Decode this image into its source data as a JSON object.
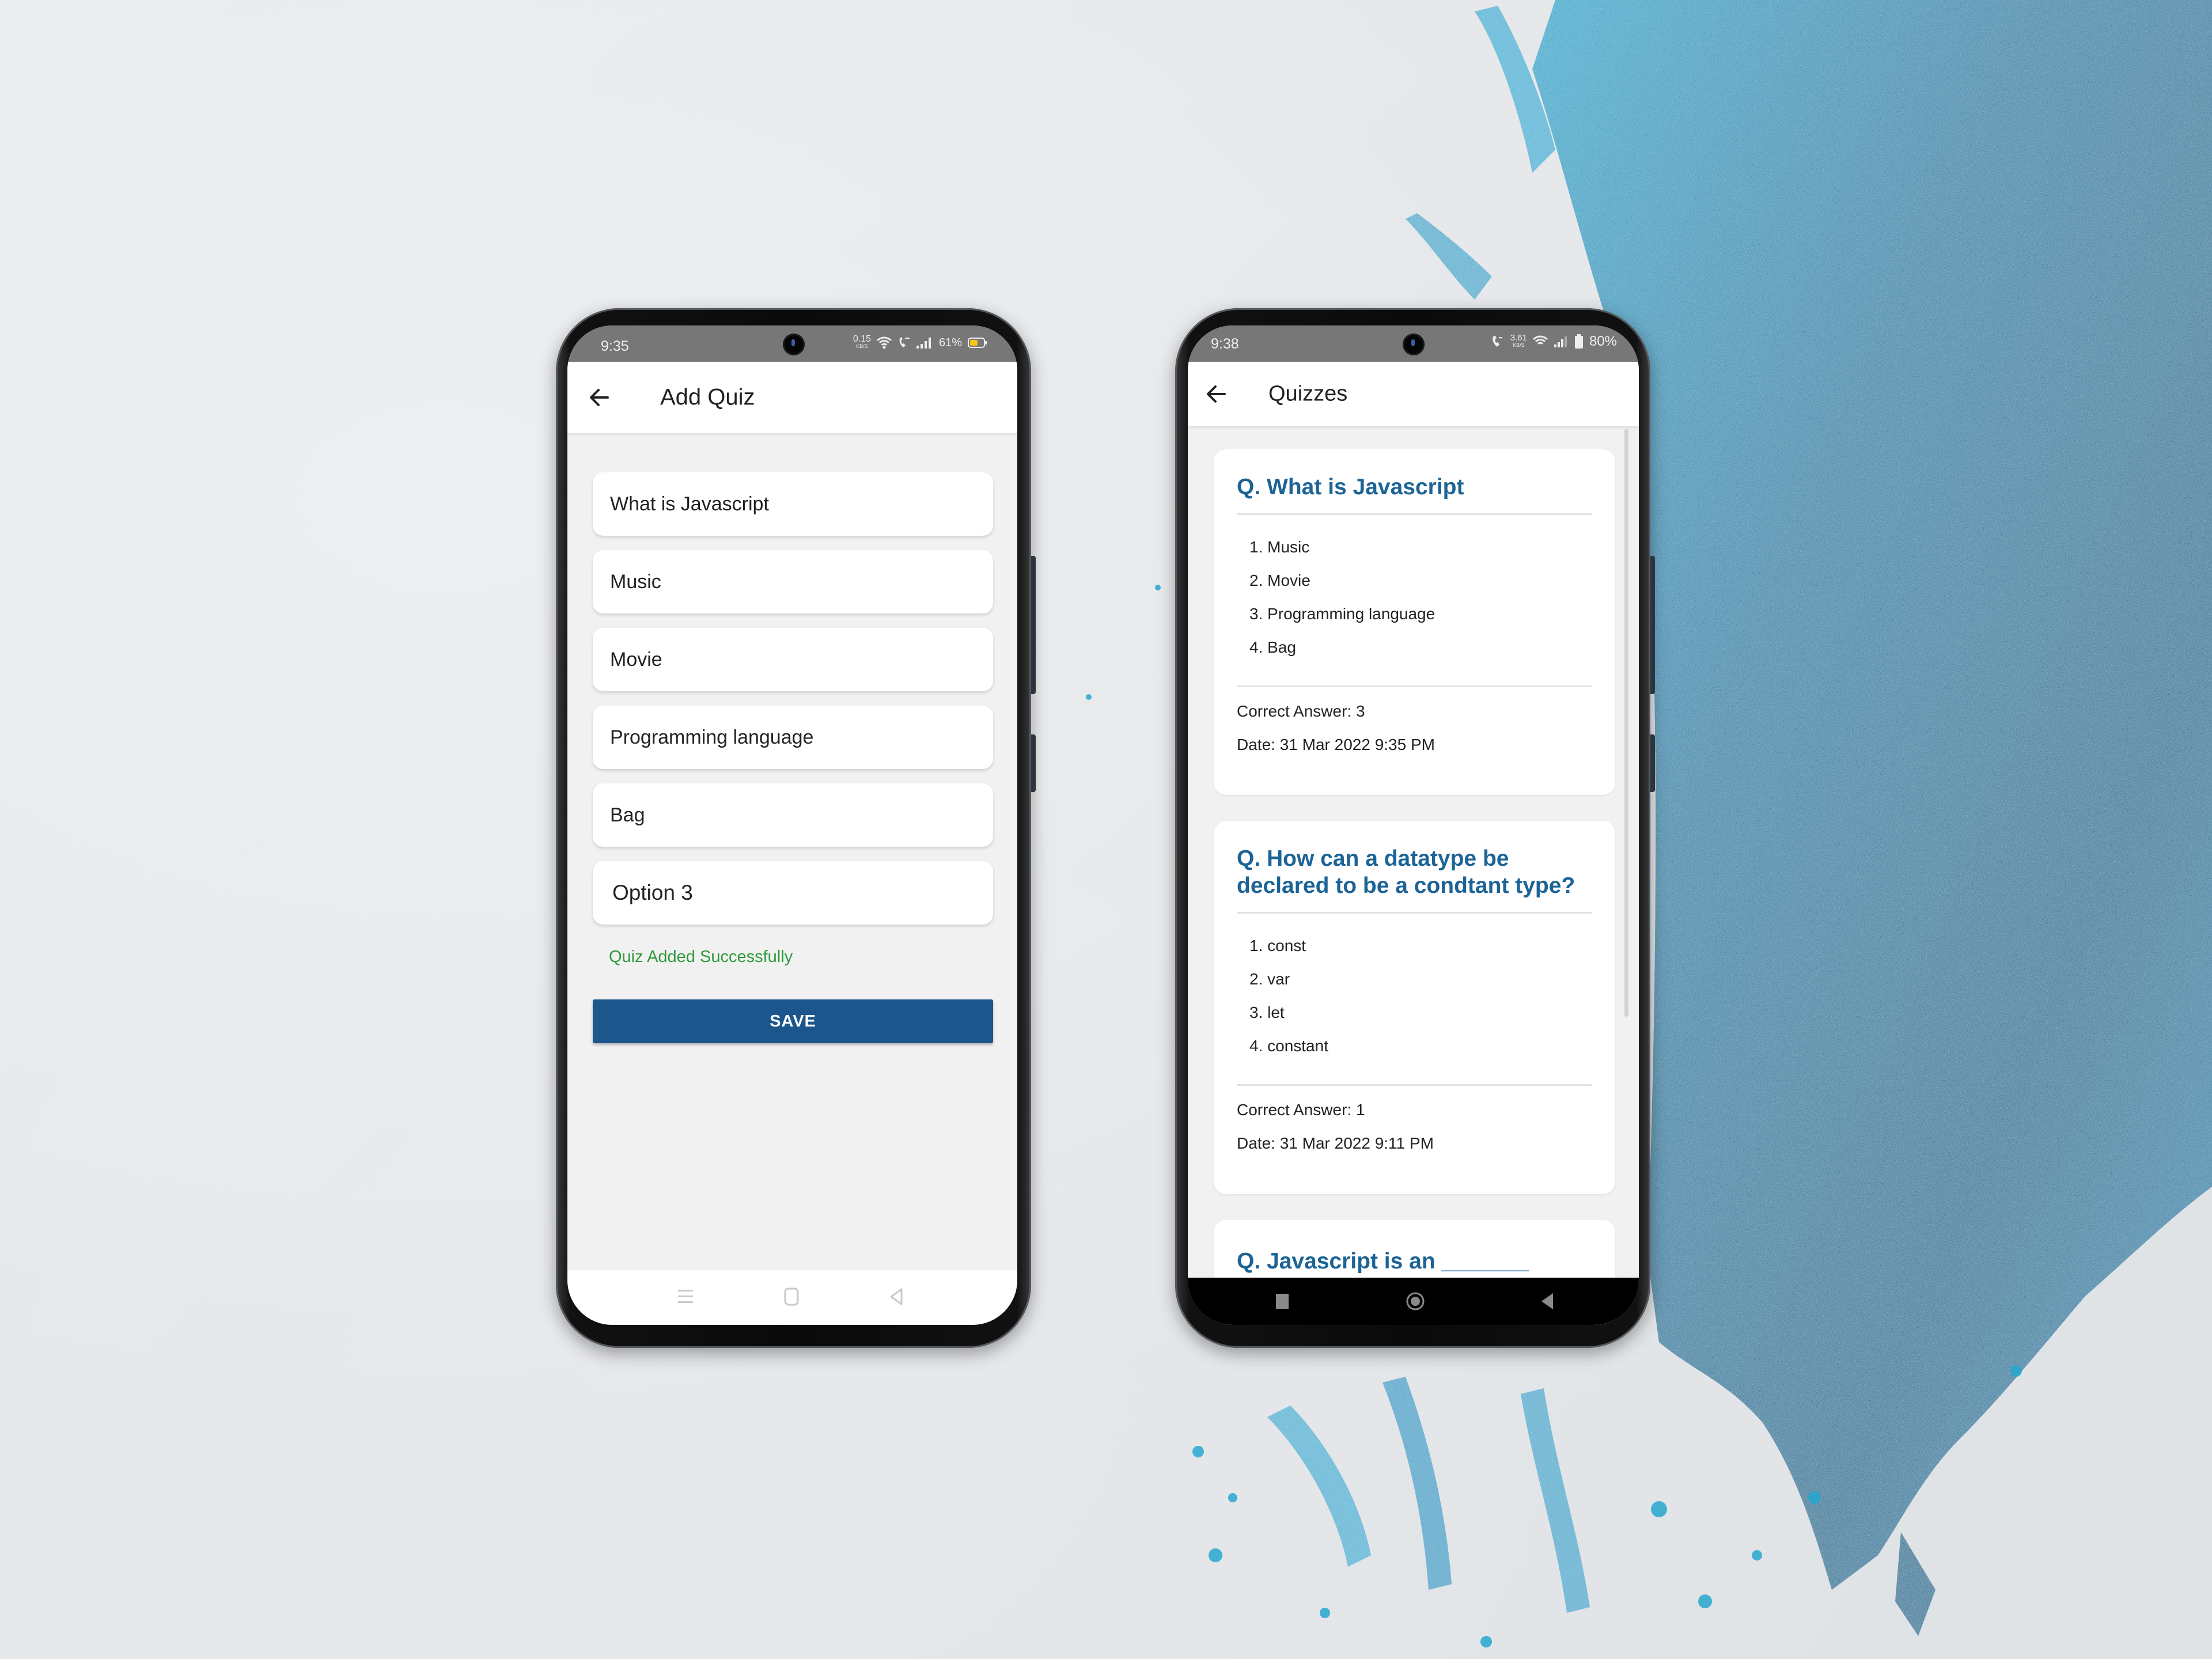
{
  "colors": {
    "primary": "#1c568d",
    "question_text": "#1d6496",
    "success": "#2e9b3a",
    "status_bar": "#777777",
    "content_bg": "#f1f1f1",
    "battery_left": "#f5c518"
  },
  "left_phone": {
    "status_bar": {
      "time": "9:35",
      "net_speed": "0.15",
      "net_unit": "KB/S",
      "battery": "61%",
      "icons": [
        "data-speed-icon",
        "wifi-icon",
        "wifi-call-icon",
        "signal-icon",
        "battery-icon"
      ]
    },
    "app_bar": {
      "back_icon": "arrow-left-icon",
      "title": "Add Quiz"
    },
    "form": {
      "question": "What is Javascript",
      "option_1": "Music",
      "option_2": "Movie",
      "option_3": "Programming language",
      "option_4": "Bag",
      "correct_answer": "Option 3"
    },
    "message": "Quiz Added Successfully",
    "save_label": "SAVE",
    "nav": [
      "menu-icon",
      "home-icon",
      "back-icon"
    ]
  },
  "right_phone": {
    "status_bar": {
      "time": "9:38",
      "net_speed": "3.61",
      "net_unit": "KB/S",
      "battery": "80%",
      "icons": [
        "wifi-call-icon",
        "data-speed-icon",
        "wifi-icon",
        "signal-icon",
        "battery-icon"
      ]
    },
    "app_bar": {
      "back_icon": "arrow-left-icon",
      "title": "Quizzes"
    },
    "quizzes": [
      {
        "question": "Q. What is Javascript",
        "options": [
          "1. Music",
          "2. Movie",
          "3. Programming language",
          "4. Bag"
        ],
        "correct_answer": "Correct Answer: 3",
        "date": "Date:  31 Mar 2022 9:35 PM"
      },
      {
        "question": "Q. How can a datatype be declared to be a condtant type?",
        "options": [
          "1. const",
          "2. var",
          "3. let",
          "4. constant"
        ],
        "correct_answer": "Correct Answer: 1",
        "date": "Date:  31 Mar 2022 9:11 PM"
      },
      {
        "question": "Q. Javascript is an _______"
      }
    ],
    "nav": [
      "recents-icon",
      "home-icon",
      "back-icon"
    ]
  }
}
